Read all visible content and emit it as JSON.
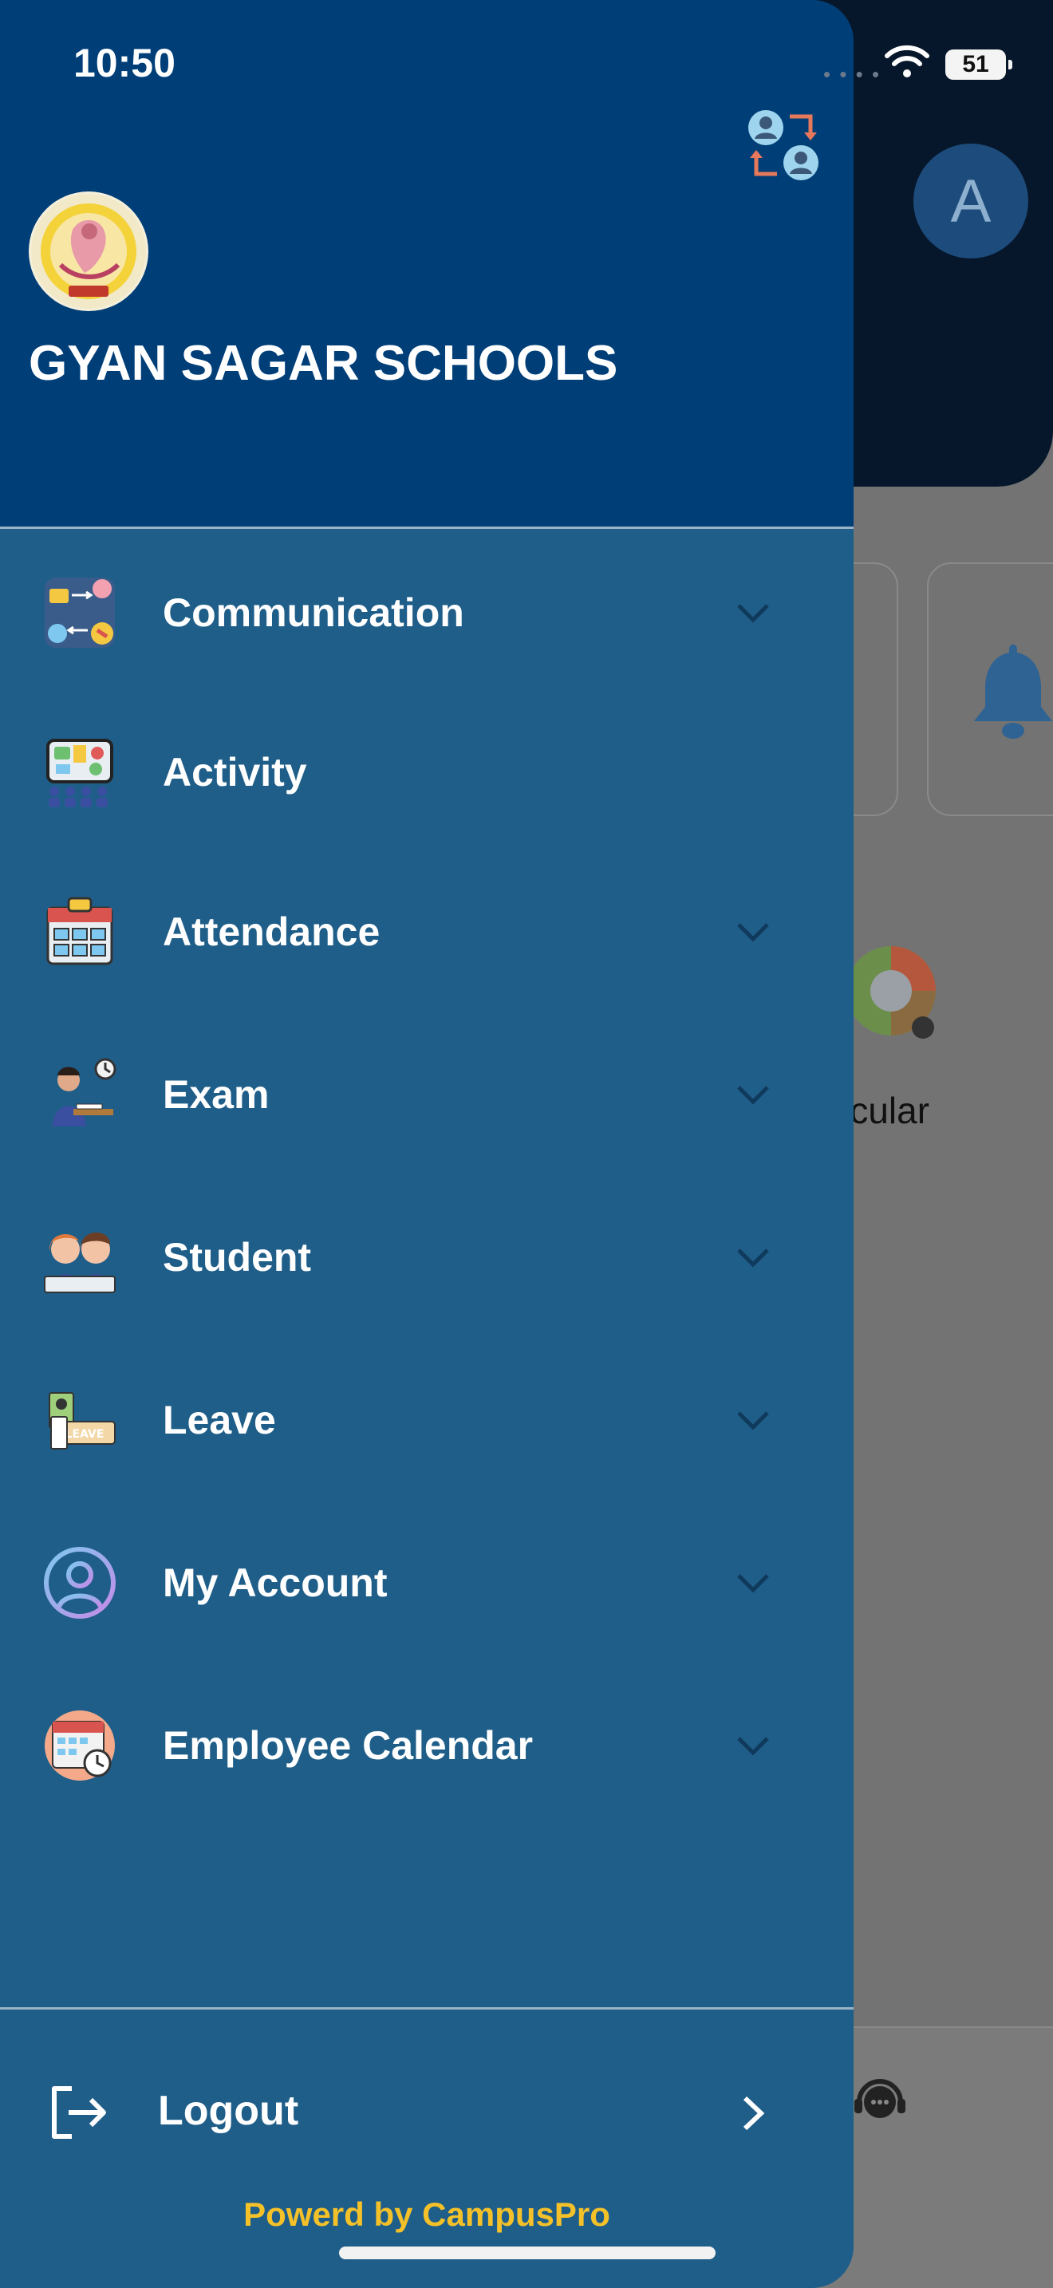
{
  "status_bar": {
    "time": "10:50",
    "battery": "51"
  },
  "background": {
    "avatar_letter": "A",
    "partial_label": "rcular"
  },
  "drawer": {
    "school_name": "GYAN SAGAR SCHOOLS",
    "menu": [
      {
        "label": "Communication",
        "icon": "communication-icon",
        "expandable": true
      },
      {
        "label": "Activity",
        "icon": "activity-icon",
        "expandable": false
      },
      {
        "label": "Attendance",
        "icon": "attendance-icon",
        "expandable": true
      },
      {
        "label": "Exam",
        "icon": "exam-icon",
        "expandable": true
      },
      {
        "label": "Student",
        "icon": "student-icon",
        "expandable": true
      },
      {
        "label": "Leave",
        "icon": "leave-icon",
        "expandable": true
      },
      {
        "label": "My Account",
        "icon": "account-icon",
        "expandable": true
      },
      {
        "label": "Employee Calendar",
        "icon": "calendar-icon",
        "expandable": true
      }
    ],
    "logout_label": "Logout",
    "powered_by": "Powerd by CampusPro"
  },
  "colors": {
    "drawer_bg": "#1f5e89",
    "header_bg": "#003e78",
    "accent_yellow": "#f5c129"
  }
}
